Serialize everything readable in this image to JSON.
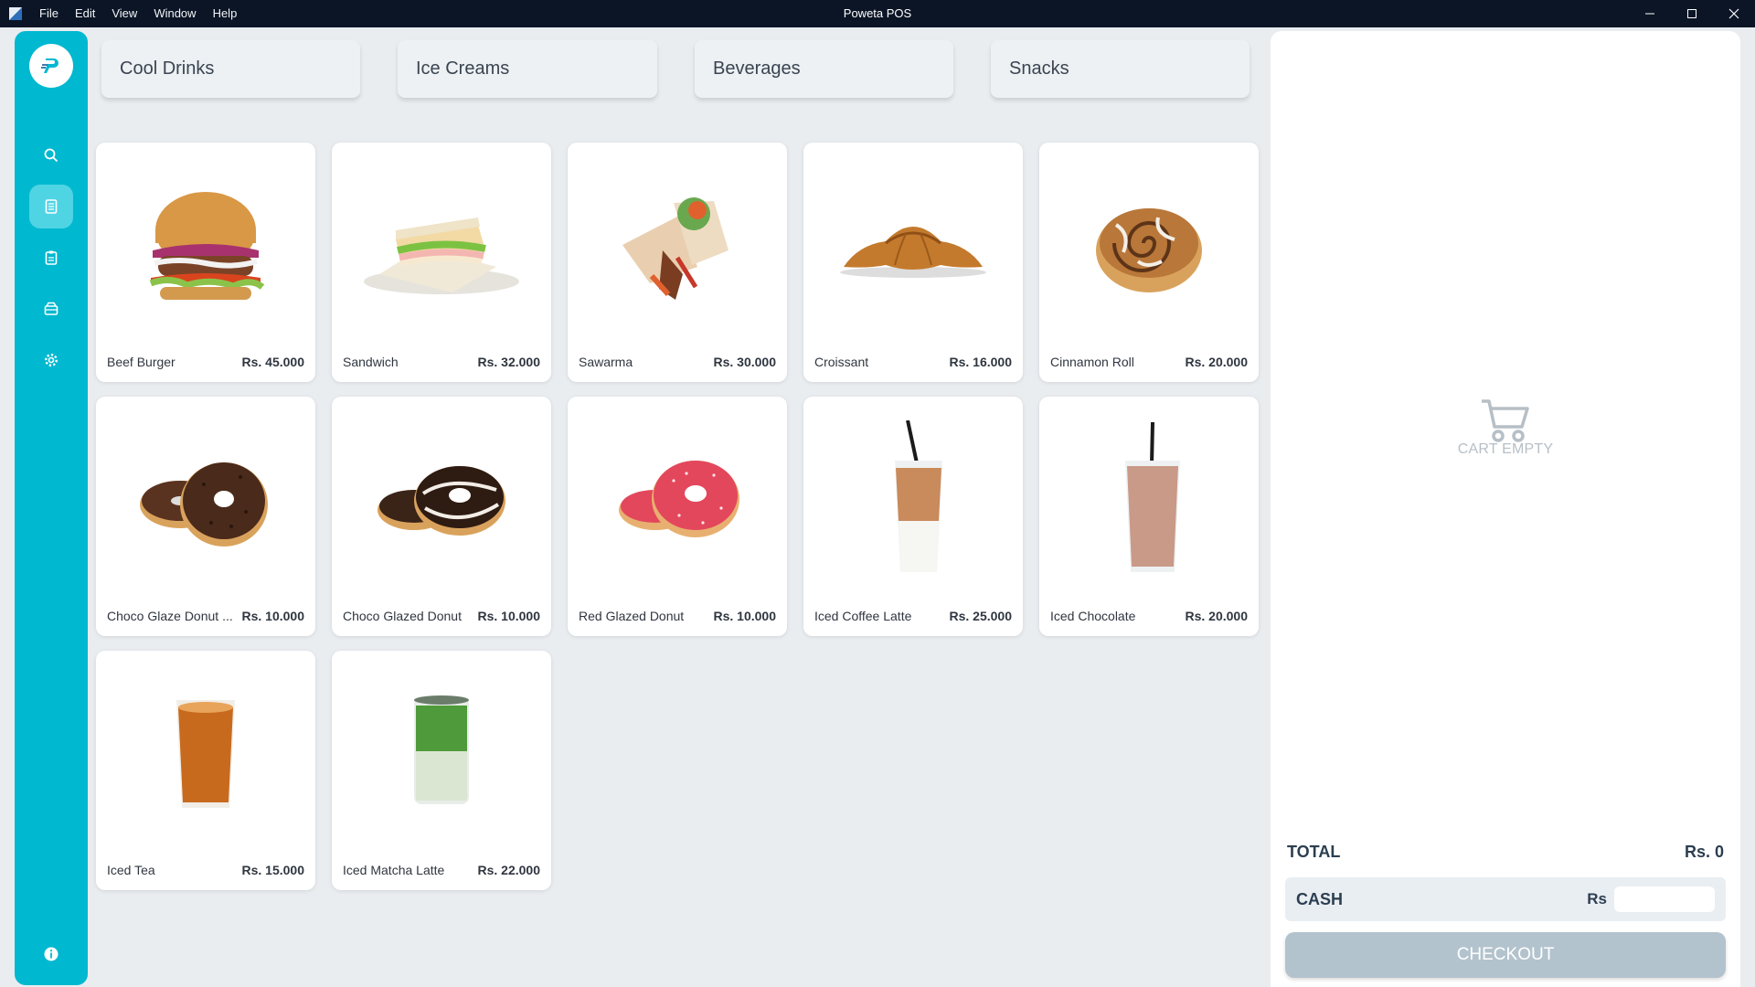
{
  "window": {
    "title": "Poweta POS",
    "menu": [
      "File",
      "Edit",
      "View",
      "Window",
      "Help"
    ]
  },
  "sidebar": {
    "active": "orders",
    "items": [
      {
        "icon": "search-icon"
      },
      {
        "icon": "orders-icon"
      },
      {
        "icon": "clipboard-icon"
      },
      {
        "icon": "inventory-icon"
      },
      {
        "icon": "gear-icon"
      }
    ],
    "info_icon": "info-icon"
  },
  "categories": [
    "Cool Drinks",
    "Ice Creams",
    "Beverages",
    "Snacks"
  ],
  "products": [
    {
      "name": "Beef Burger",
      "price": "Rs. 45.000",
      "image": "burger"
    },
    {
      "name": "Sandwich",
      "price": "Rs. 32.000",
      "image": "sandwich"
    },
    {
      "name": "Sawarma",
      "price": "Rs. 30.000",
      "image": "wrap"
    },
    {
      "name": "Croissant",
      "price": "Rs. 16.000",
      "image": "croissant"
    },
    {
      "name": "Cinnamon Roll",
      "price": "Rs. 20.000",
      "image": "cinnamon-roll"
    },
    {
      "name": "Choco Glaze Donut ...",
      "price": "Rs. 10.000",
      "image": "donut-choco-sprinkle"
    },
    {
      "name": "Choco Glazed Donut",
      "price": "Rs. 10.000",
      "image": "donut-choco"
    },
    {
      "name": "Red Glazed Donut",
      "price": "Rs. 10.000",
      "image": "donut-red"
    },
    {
      "name": "Iced Coffee Latte",
      "price": "Rs. 25.000",
      "image": "iced-latte"
    },
    {
      "name": "Iced Chocolate",
      "price": "Rs. 20.000",
      "image": "iced-chocolate"
    },
    {
      "name": "Iced Tea",
      "price": "Rs. 15.000",
      "image": "iced-tea"
    },
    {
      "name": "Iced Matcha Latte",
      "price": "Rs. 22.000",
      "image": "iced-matcha"
    }
  ],
  "cart": {
    "empty_text": "CART EMPTY",
    "total_label": "TOTAL",
    "total_value": "Rs. 0",
    "cash_label": "CASH",
    "cash_currency": "Rs",
    "cash_value": "",
    "checkout_label": "CHECKOUT"
  },
  "colors": {
    "accent": "#00b8d0",
    "titlebar": "#0b1526",
    "checkout_disabled": "#b3c3cd"
  }
}
